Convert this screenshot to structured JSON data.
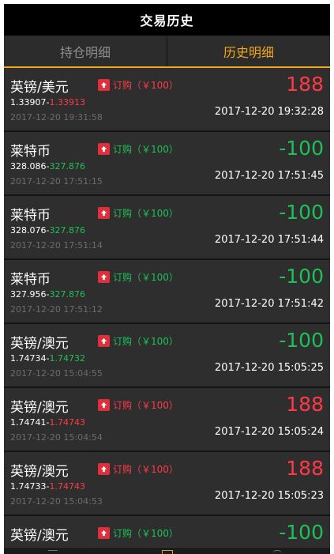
{
  "header": {
    "title": "交易历史"
  },
  "tabs": [
    {
      "label": "持仓明细",
      "active": false
    },
    {
      "label": "历史明细",
      "active": true
    }
  ],
  "colors": {
    "accent": "#f0a81b",
    "up": "#ff3a46",
    "down": "#1ec157",
    "badge_bg": "#e02f3a"
  },
  "records": [
    {
      "name": "英镑/美元",
      "order": "订购（￥100）",
      "order_color": "red",
      "open_price": "1.33907-",
      "close_price": "1.33913",
      "close_color": "red",
      "open_time": "2017-12-20 19:31:58",
      "profit": "188",
      "profit_color": "red",
      "close_time": "2017-12-20 19:32:28"
    },
    {
      "name": "莱特币",
      "order": "订购（￥100）",
      "order_color": "green",
      "open_price": "328.086-",
      "close_price": "327.876",
      "close_color": "green",
      "open_time": "2017-12-20 17:51:15",
      "profit": "-100",
      "profit_color": "green",
      "close_time": "2017-12-20 17:51:45"
    },
    {
      "name": "莱特币",
      "order": "订购（￥100）",
      "order_color": "green",
      "open_price": "328.076-",
      "close_price": "327.876",
      "close_color": "green",
      "open_time": "2017-12-20 17:51:14",
      "profit": "-100",
      "profit_color": "green",
      "close_time": "2017-12-20 17:51:44"
    },
    {
      "name": "莱特币",
      "order": "订购（￥100）",
      "order_color": "green",
      "open_price": "327.956-",
      "close_price": "327.876",
      "close_color": "green",
      "open_time": "2017-12-20 17:51:12",
      "profit": "-100",
      "profit_color": "green",
      "close_time": "2017-12-20 17:51:42"
    },
    {
      "name": "英镑/澳元",
      "order": "订购（￥100）",
      "order_color": "green",
      "open_price": "1.74734-",
      "close_price": "1.74732",
      "close_color": "green",
      "open_time": "2017-12-20 15:04:55",
      "profit": "-100",
      "profit_color": "green",
      "close_time": "2017-12-20 15:05:25"
    },
    {
      "name": "英镑/澳元",
      "order": "订购（￥100）",
      "order_color": "red",
      "open_price": "1.74741-",
      "close_price": "1.74743",
      "close_color": "red",
      "open_time": "2017-12-20 15:04:54",
      "profit": "188",
      "profit_color": "red",
      "close_time": "2017-12-20 15:05:24"
    },
    {
      "name": "英镑/澳元",
      "order": "订购（￥100）",
      "order_color": "red",
      "open_price": "1.74733-",
      "close_price": "1.74743",
      "close_color": "red",
      "open_time": "2017-12-20 15:04:53",
      "profit": "188",
      "profit_color": "red",
      "close_time": "2017-12-20 15:05:23"
    },
    {
      "name": "英镑/澳元",
      "order": "订购（￥100）",
      "order_color": "green",
      "open_price": "",
      "close_price": "",
      "close_color": "green",
      "open_time": "",
      "profit": "-100",
      "profit_color": "green",
      "close_time": ""
    }
  ]
}
